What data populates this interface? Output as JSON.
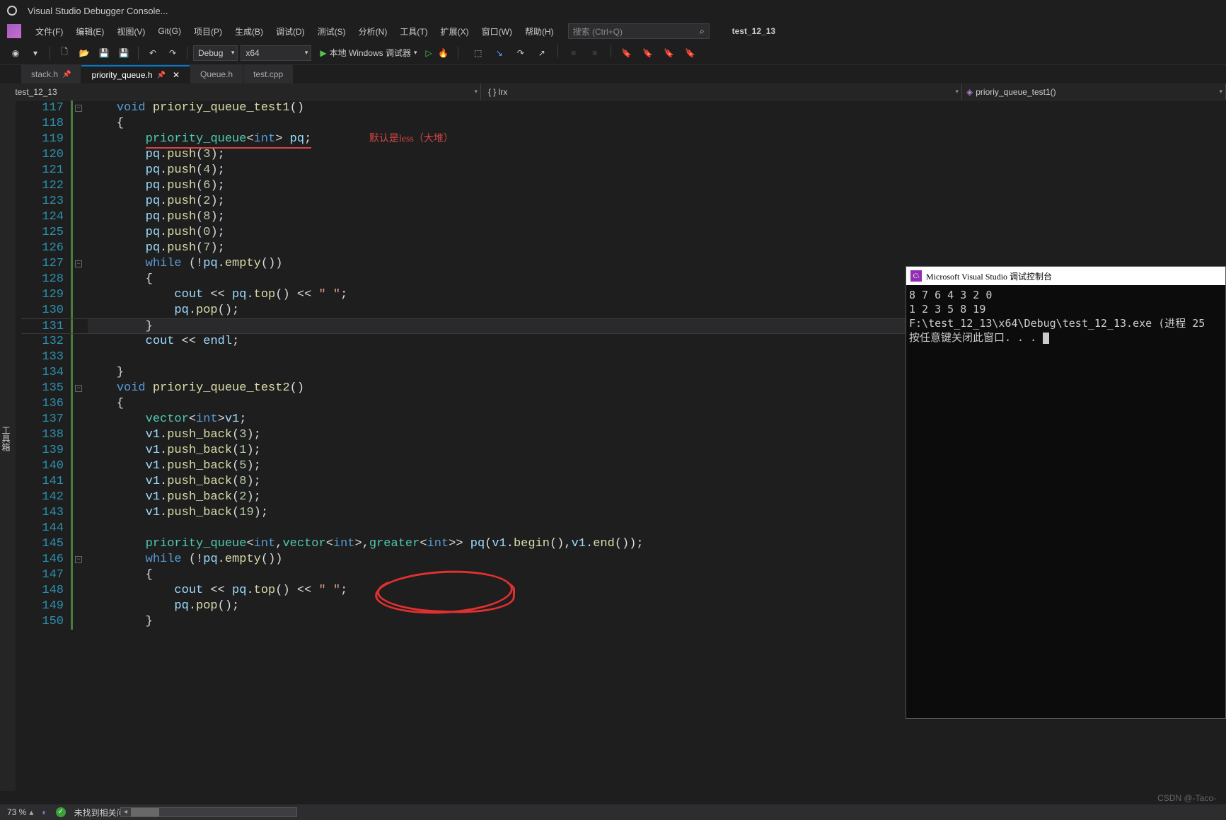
{
  "titlebar": {
    "text": "Visual Studio Debugger Console..."
  },
  "menubar": {
    "items": [
      "文件(F)",
      "编辑(E)",
      "视图(V)",
      "Git(G)",
      "项目(P)",
      "生成(B)",
      "调试(D)",
      "测试(S)",
      "分析(N)",
      "工具(T)",
      "扩展(X)",
      "窗口(W)",
      "帮助(H)"
    ],
    "search_placeholder": "搜索 (Ctrl+Q)",
    "solution": "test_12_13"
  },
  "toolbar": {
    "config": "Debug",
    "platform": "x64",
    "run_label": "本地 Windows 调试器"
  },
  "tabs": [
    {
      "label": "stack.h",
      "pinned": true,
      "active": false
    },
    {
      "label": "priority_queue.h",
      "pinned": true,
      "active": true
    },
    {
      "label": "Queue.h",
      "pinned": false,
      "active": false
    },
    {
      "label": "test.cpp",
      "pinned": false,
      "active": false
    }
  ],
  "navbar": {
    "project": "test_12_13",
    "namespace": "{ } lrx",
    "function": "prioriy_queue_test1()"
  },
  "sidebar_left": "工具箱",
  "code": {
    "annotation_comment": "默认是less（大堆）",
    "lines": [
      {
        "n": 117,
        "fold": "−",
        "html": "    <span class='kw'>void</span> <span class='fn'>prioriy_queue_test1</span>()"
      },
      {
        "n": 118,
        "html": "    {"
      },
      {
        "n": 119,
        "html": "        <span class='tp underline-red'>priority_queue</span><span class='underline-red'>&lt;<span class='kw'>int</span>&gt; <span class='vr'>pq</span>;</span>        <span class='annot'>默认是less（大堆）</span>"
      },
      {
        "n": 120,
        "html": "        <span class='vr'>pq</span>.<span class='fn'>push</span>(<span class='num'>3</span>);"
      },
      {
        "n": 121,
        "html": "        <span class='vr'>pq</span>.<span class='fn'>push</span>(<span class='num'>4</span>);"
      },
      {
        "n": 122,
        "html": "        <span class='vr'>pq</span>.<span class='fn'>push</span>(<span class='num'>6</span>);"
      },
      {
        "n": 123,
        "html": "        <span class='vr'>pq</span>.<span class='fn'>push</span>(<span class='num'>2</span>);"
      },
      {
        "n": 124,
        "html": "        <span class='vr'>pq</span>.<span class='fn'>push</span>(<span class='num'>8</span>);"
      },
      {
        "n": 125,
        "html": "        <span class='vr'>pq</span>.<span class='fn'>push</span>(<span class='num'>0</span>);"
      },
      {
        "n": 126,
        "html": "        <span class='vr'>pq</span>.<span class='fn'>push</span>(<span class='num'>7</span>);"
      },
      {
        "n": 127,
        "fold": "−",
        "html": "        <span class='kw'>while</span> (!<span class='vr'>pq</span>.<span class='fn'>empty</span>())"
      },
      {
        "n": 128,
        "html": "        {"
      },
      {
        "n": 129,
        "html": "            <span class='vr'>cout</span> &lt;&lt; <span class='vr'>pq</span>.<span class='fn'>top</span>() &lt;&lt; <span class='str'>\" \"</span>;"
      },
      {
        "n": 130,
        "html": "            <span class='vr'>pq</span>.<span class='fn'>pop</span>();"
      },
      {
        "n": 131,
        "hl": true,
        "html": "        }"
      },
      {
        "n": 132,
        "html": "        <span class='vr'>cout</span> &lt;&lt; <span class='vr'>endl</span>;"
      },
      {
        "n": 133,
        "html": ""
      },
      {
        "n": 134,
        "html": "    }"
      },
      {
        "n": 135,
        "fold": "−",
        "html": "    <span class='kw'>void</span> <span class='fn'>prioriy_queue_test2</span>()"
      },
      {
        "n": 136,
        "html": "    {"
      },
      {
        "n": 137,
        "html": "        <span class='tp'>vector</span>&lt;<span class='kw'>int</span>&gt;<span class='vr'>v1</span>;"
      },
      {
        "n": 138,
        "html": "        <span class='vr'>v1</span>.<span class='fn'>push_back</span>(<span class='num'>3</span>);"
      },
      {
        "n": 139,
        "html": "        <span class='vr'>v1</span>.<span class='fn'>push_back</span>(<span class='num'>1</span>);"
      },
      {
        "n": 140,
        "html": "        <span class='vr'>v1</span>.<span class='fn'>push_back</span>(<span class='num'>5</span>);"
      },
      {
        "n": 141,
        "html": "        <span class='vr'>v1</span>.<span class='fn'>push_back</span>(<span class='num'>8</span>);"
      },
      {
        "n": 142,
        "html": "        <span class='vr'>v1</span>.<span class='fn'>push_back</span>(<span class='num'>2</span>);"
      },
      {
        "n": 143,
        "html": "        <span class='vr'>v1</span>.<span class='fn'>push_back</span>(<span class='num'>19</span>);"
      },
      {
        "n": 144,
        "html": ""
      },
      {
        "n": 145,
        "html": "        <span class='tp'>priority_queue</span>&lt;<span class='kw'>int</span>,<span class='tp'>vector</span>&lt;<span class='kw'>int</span>&gt;,<span class='tp'>greater</span>&lt;<span class='kw'>int</span>&gt;&gt; <span class='vr'>pq</span>(<span class='vr'>v1</span>.<span class='fn'>begin</span>(),<span class='vr'>v1</span>.<span class='fn'>end</span>());"
      },
      {
        "n": 146,
        "fold": "−",
        "html": "        <span class='kw'>while</span> (!<span class='vr'>pq</span>.<span class='fn'>empty</span>())"
      },
      {
        "n": 147,
        "html": "        {"
      },
      {
        "n": 148,
        "html": "            <span class='vr'>cout</span> &lt;&lt; <span class='vr'>pq</span>.<span class='fn'>top</span>() &lt;&lt; <span class='str'>\" \"</span>;"
      },
      {
        "n": 149,
        "html": "            <span class='vr'>pq</span>.<span class='fn'>pop</span>();"
      },
      {
        "n": 150,
        "html": "        }"
      }
    ]
  },
  "console": {
    "title": "Microsoft Visual Studio 调试控制台",
    "line1": "8 7 6 4 3 2 0",
    "line2": "1 2 3 5 8 19",
    "line3": "F:\\test_12_13\\x64\\Debug\\test_12_13.exe (进程 25",
    "line4": "按任意键关闭此窗口. . . "
  },
  "statusbar": {
    "zoom": "73 %",
    "issues": "未找到相关问题"
  },
  "watermark": "CSDN @-Taco-"
}
